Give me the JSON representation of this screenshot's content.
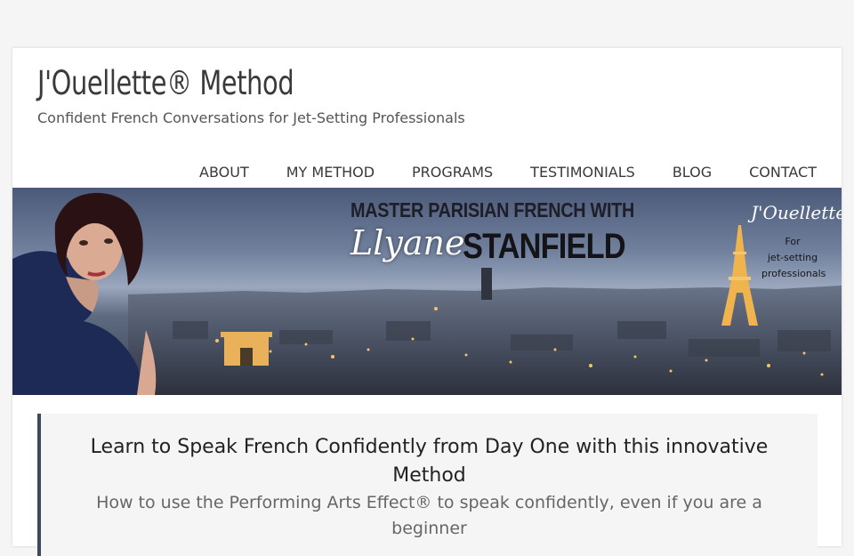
{
  "header": {
    "site_title": "J'Ouellette® Method",
    "tagline": "Confident French Conversations for Jet-Setting Professionals"
  },
  "nav": {
    "items": [
      "ABOUT",
      "MY METHOD",
      "PROGRAMS",
      "TESTIMONIALS",
      "BLOG",
      "CONTACT"
    ]
  },
  "hero": {
    "title_line": "MASTER PARISIAN FRENCH WITH",
    "first_name": "Llyane",
    "last_name": "STANFIELD",
    "brand_signature": "J'Ouellette",
    "brand_lines": [
      "For",
      "jet-setting",
      "professionals"
    ]
  },
  "intro": {
    "heading": "Learn to Speak French Confidently from Day One with this innovative Method",
    "subheading": "How to use the Performing Arts Effect® to speak confidently, even if you are a beginner"
  },
  "colors": {
    "page_background": "#f5f5f5",
    "text_dark": "#3a3a3a",
    "accent_border": "#3d4a5c"
  }
}
